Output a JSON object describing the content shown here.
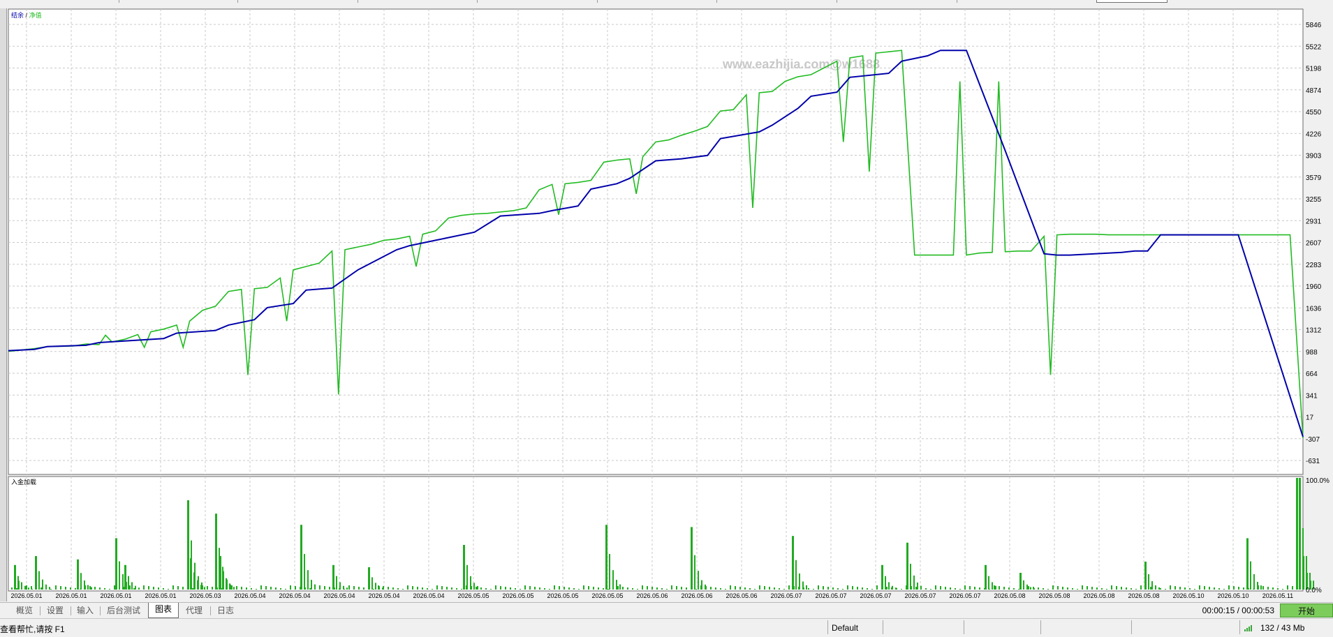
{
  "watermark": "www.eazhijia.com@w1688",
  "equity_chart": {
    "legend_balance": "结余",
    "legend_sep": "/",
    "legend_equity": "净值",
    "y_labels": [
      "5846",
      "5522",
      "5198",
      "4874",
      "4550",
      "4226",
      "3903",
      "3579",
      "3255",
      "2931",
      "2607",
      "2283",
      "1960",
      "1636",
      "1312",
      "988",
      "664",
      "341",
      "17",
      "-307",
      "-631"
    ],
    "colors": {
      "balance": "#0000aa",
      "equity": "#22bb22",
      "grid": "#c8c8c8",
      "background": "#ffffff"
    }
  },
  "deposit_chart": {
    "label": "入金加载",
    "y_top": "100.0%",
    "y_bottom": "0.0%",
    "bar_color": "#22aa22"
  },
  "x_labels": [
    "2026.05.01",
    "2026.05.01",
    "2026.05.01",
    "2026.05.01",
    "2026.05.03",
    "2026.05.04",
    "2026.05.04",
    "2026.05.04",
    "2026.05.04",
    "2026.05.04",
    "2026.05.05",
    "2026.05.05",
    "2026.05.05",
    "2026.05.05",
    "2026.05.06",
    "2026.05.06",
    "2026.05.06",
    "2026.05.07",
    "2026.05.07",
    "2026.05.07",
    "2026.05.07",
    "2026.05.07",
    "2026.05.08",
    "2026.05.08",
    "2026.05.08",
    "2026.05.08",
    "2026.05.10",
    "2026.05.10",
    "2026.05.11"
  ],
  "chart_data": {
    "type": "line",
    "x_axis_labels": [
      "2026.05.01",
      "2026.05.01",
      "2026.05.01",
      "2026.05.01",
      "2026.05.03",
      "2026.05.04",
      "2026.05.04",
      "2026.05.04",
      "2026.05.04",
      "2026.05.04",
      "2026.05.05",
      "2026.05.05",
      "2026.05.05",
      "2026.05.05",
      "2026.05.06",
      "2026.05.06",
      "2026.05.06",
      "2026.05.07",
      "2026.05.07",
      "2026.05.07",
      "2026.05.07",
      "2026.05.07",
      "2026.05.08",
      "2026.05.08",
      "2026.05.08",
      "2026.05.08",
      "2026.05.10",
      "2026.05.10",
      "2026.05.11"
    ],
    "ylim": [
      -631,
      5846
    ],
    "grid": true,
    "series": [
      {
        "name": "结余",
        "x": [
          0,
          2,
          3,
          6,
          7,
          12,
          13,
          16,
          17,
          19,
          20,
          22,
          23,
          25,
          27,
          30,
          31,
          33,
          34,
          36,
          38,
          41,
          42,
          44,
          45,
          47,
          48,
          50,
          52,
          54,
          55,
          58,
          59,
          61,
          62,
          64,
          65,
          68,
          69,
          71,
          72,
          74,
          77,
          80,
          81,
          82,
          86,
          87,
          88,
          89,
          94,
          95,
          100
        ],
        "y": [
          1000,
          1020,
          1060,
          1080,
          1120,
          1180,
          1260,
          1300,
          1380,
          1460,
          1640,
          1700,
          1900,
          1930,
          2200,
          2500,
          2560,
          2640,
          2680,
          2760,
          3000,
          3040,
          3080,
          3150,
          3400,
          3480,
          3560,
          3820,
          3850,
          3900,
          4150,
          4250,
          4350,
          4600,
          4780,
          4840,
          5060,
          5120,
          5300,
          5380,
          5460,
          5460,
          3970,
          2440,
          2420,
          2420,
          2460,
          2480,
          2480,
          2720,
          2720,
          2720,
          -280
        ]
      },
      {
        "name": "净值",
        "x": [
          0,
          1,
          2,
          3,
          5,
          6,
          7,
          8,
          9,
          10,
          11,
          12,
          12.5,
          13,
          14,
          15,
          16,
          17,
          18,
          19,
          20,
          21,
          22,
          23,
          24,
          25,
          26,
          27,
          28,
          29,
          30,
          31,
          32,
          33,
          34,
          35,
          36,
          37,
          38,
          39,
          40,
          41,
          42,
          43,
          44,
          45,
          46,
          47,
          48,
          49,
          50,
          51,
          52,
          53,
          54,
          55,
          56,
          57,
          58,
          59,
          60,
          61,
          62,
          63,
          64,
          65,
          66,
          67,
          68,
          69,
          70,
          71,
          72,
          73,
          74,
          75,
          76,
          77,
          78,
          79,
          80,
          81,
          82,
          83,
          84,
          85,
          86,
          87,
          88,
          89,
          90,
          91,
          92,
          93,
          94,
          95,
          96,
          97,
          98,
          99,
          100
        ],
        "y": [
          990,
          1010,
          1030,
          1060,
          1070,
          1100,
          1090,
          1130,
          1170,
          1240,
          1280,
          1320,
          1350,
          1380,
          1440,
          1600,
          1660,
          1880,
          1910,
          1920,
          1940,
          2080,
          2200,
          2250,
          2300,
          2480,
          2500,
          2540,
          2580,
          2640,
          2660,
          2700,
          2730,
          2780,
          2970,
          3010,
          3030,
          3040,
          3060,
          3080,
          3120,
          3390,
          3470,
          3480,
          3500,
          3530,
          3800,
          3830,
          3850,
          3880,
          4100,
          4130,
          4200,
          4260,
          4330,
          4560,
          4580,
          4800,
          4830,
          4850,
          5000,
          5070,
          5100,
          5200,
          5300,
          5350,
          5380,
          5420,
          5440,
          5460,
          2420,
          2420,
          2420,
          2420,
          2420,
          2450,
          2460,
          2470,
          2480,
          2480,
          2700,
          2720,
          2730,
          2730,
          2730,
          2720,
          2720,
          2720,
          2720,
          2720,
          2720,
          2720,
          2720,
          2720,
          2720,
          2720,
          2720,
          2720,
          2720,
          2720,
          -300
        ]
      }
    ]
  },
  "tabs": [
    {
      "label": "概览"
    },
    {
      "label": "设置"
    },
    {
      "label": "输入"
    },
    {
      "label": "后台测试"
    },
    {
      "label": "图表"
    },
    {
      "label": "代理"
    },
    {
      "label": "日志"
    }
  ],
  "timer": "00:00:15 / 00:00:53",
  "start_button": "开始",
  "status": {
    "help": "查看帮忙,请按 F1",
    "profile": "Default",
    "memory": "132 / 43 Mb"
  }
}
